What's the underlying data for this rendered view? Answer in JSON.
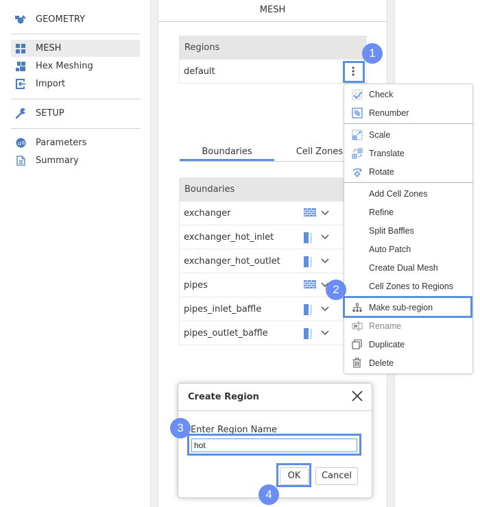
{
  "sidebar": {
    "items": [
      {
        "label": "GEOMETRY",
        "icon": "shapes-icon"
      },
      {
        "label": "MESH",
        "icon": "grid-icon",
        "active": true
      },
      {
        "label": "Hex Meshing",
        "icon": "hex-mesh-icon"
      },
      {
        "label": "Import",
        "icon": "import-icon"
      },
      {
        "label": "SETUP",
        "icon": "wrench-icon"
      },
      {
        "label": "Parameters",
        "icon": "parameters-icon"
      },
      {
        "label": "Summary",
        "icon": "document-icon"
      }
    ]
  },
  "panel": {
    "title": "MESH",
    "regions": {
      "header": "Regions",
      "rows": [
        {
          "name": "default"
        }
      ]
    },
    "tabs": [
      {
        "label": "Boundaries",
        "active": true
      },
      {
        "label": "Cell Zones",
        "active": false
      }
    ],
    "boundaries": {
      "header": "Boundaries",
      "rows": [
        {
          "name": "exchanger",
          "type_icon": "wall-icon"
        },
        {
          "name": "exchanger_hot_inlet",
          "type_icon": "patch-icon"
        },
        {
          "name": "exchanger_hot_outlet",
          "type_icon": "patch-icon"
        },
        {
          "name": "pipes",
          "type_icon": "wall-icon"
        },
        {
          "name": "pipes_inlet_baffle",
          "type_icon": "patch-icon"
        },
        {
          "name": "pipes_outlet_baffle",
          "type_icon": "patch-icon"
        }
      ]
    }
  },
  "context_menu": {
    "items": [
      {
        "label": "Check",
        "icon": "check-icon"
      },
      {
        "label": "Renumber",
        "icon": "renumber-icon"
      },
      {
        "label": "Scale",
        "icon": "scale-icon"
      },
      {
        "label": "Translate",
        "icon": "translate-icon"
      },
      {
        "label": "Rotate",
        "icon": "rotate-icon"
      },
      {
        "label": "Add Cell Zones"
      },
      {
        "label": "Refine"
      },
      {
        "label": "Split Baffles"
      },
      {
        "label": "Auto Patch"
      },
      {
        "label": "Create Dual Mesh"
      },
      {
        "label": "Cell Zones to Regions"
      },
      {
        "label": "Make sub-region",
        "icon": "hierarchy-icon",
        "highlighted": true
      },
      {
        "label": "Rename",
        "icon": "rename-icon",
        "disabled": true
      },
      {
        "label": "Duplicate",
        "icon": "duplicate-icon"
      },
      {
        "label": "Delete",
        "icon": "trash-icon"
      }
    ]
  },
  "dialog": {
    "title": "Create Region",
    "field_label": "Enter Region Name",
    "field_value": "hot",
    "ok_label": "OK",
    "cancel_label": "Cancel"
  },
  "annotations": {
    "steps": [
      "1",
      "2",
      "3",
      "4"
    ],
    "accent_color": "#6b8ef5",
    "highlight_color": "#5b8fe0"
  }
}
